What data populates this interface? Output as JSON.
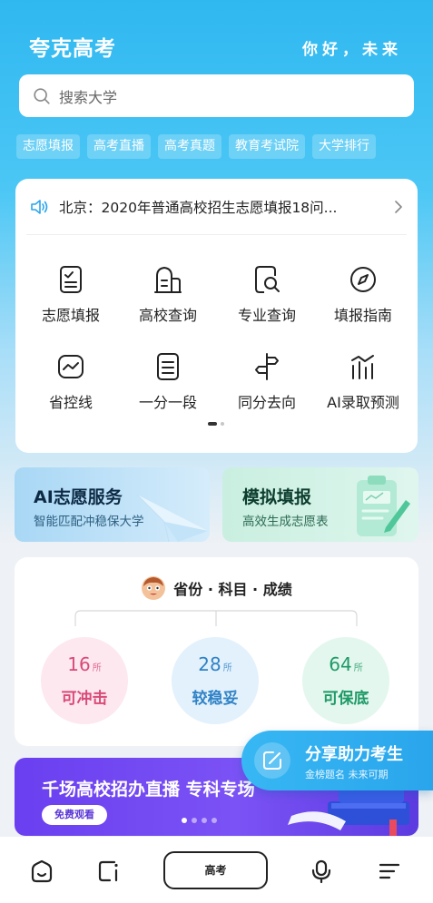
{
  "header": {
    "app_title": "夸克高考",
    "slogan": "你好，未来"
  },
  "search": {
    "placeholder": "搜索大学"
  },
  "quick_tags": [
    "志愿填报",
    "高考直播",
    "高考真题",
    "教育考试院",
    "大学排行"
  ],
  "notice": {
    "text": "北京：2020年普通高校招生志愿填报18问..."
  },
  "grid": [
    {
      "label": "志愿填报",
      "icon": "form-icon"
    },
    {
      "label": "高校查询",
      "icon": "building-icon"
    },
    {
      "label": "专业查询",
      "icon": "doc-search-icon"
    },
    {
      "label": "填报指南",
      "icon": "compass-icon"
    },
    {
      "label": "省控线",
      "icon": "line-chart-icon"
    },
    {
      "label": "一分一段",
      "icon": "list-icon"
    },
    {
      "label": "同分去向",
      "icon": "signpost-icon"
    },
    {
      "label": "AI录取预测",
      "icon": "bar-chart-icon"
    }
  ],
  "promo": {
    "ai": {
      "title": "AI志愿服务",
      "subtitle": "智能匹配冲稳保大学"
    },
    "sim": {
      "title": "模拟填报",
      "subtitle": "高效生成志愿表"
    }
  },
  "score_card": {
    "title": "省份 · 科目 · 成绩",
    "unit": "所",
    "tiers": [
      {
        "count": "16",
        "label": "可冲击",
        "color": "#d84a78"
      },
      {
        "count": "28",
        "label": "较稳妥",
        "color": "#2f82c6"
      },
      {
        "count": "64",
        "label": "可保底",
        "color": "#1f9a67"
      }
    ]
  },
  "banner": {
    "title": "千场高校招办直播 专科专场",
    "button": "免费观看"
  },
  "share": {
    "title": "分享助力考生",
    "subtitle": "金榜题名 未来可期"
  },
  "tabbar": {
    "center_label": "高考"
  },
  "colors": {
    "accent": "#2fb8f0",
    "banner": "#6a3ff0"
  }
}
